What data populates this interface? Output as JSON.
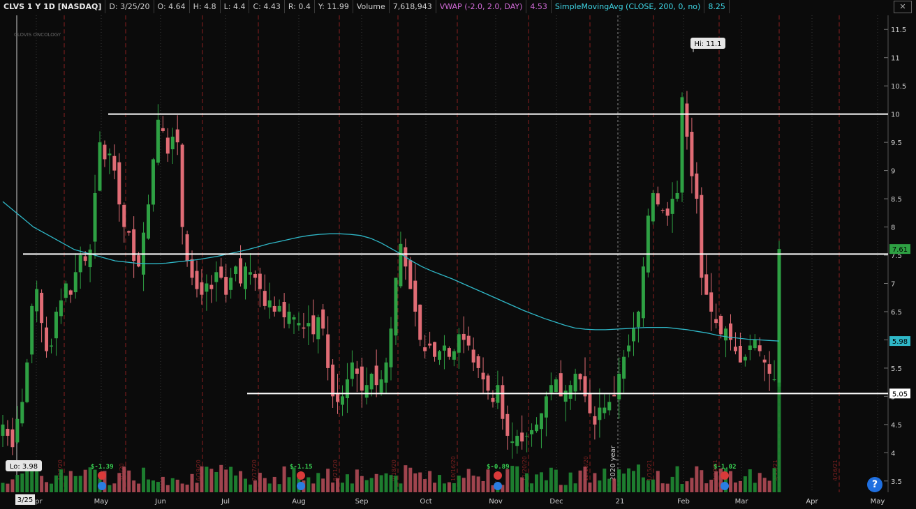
{
  "header": {
    "symbol": "CLVS 1 Y 1D [NASDAQ]",
    "date": "D: 3/25/20",
    "open": "O: 4.64",
    "high": "H: 4.8",
    "low": "L: 4.4",
    "close": "C: 4.43",
    "range": "R: 0.4",
    "year_high": "Y: 11.99",
    "volume_label": "Volume",
    "volume_value": "7,618,943",
    "vwap_label": "VWAP (-2.0, 2.0, DAY)",
    "vwap_value": "4.53",
    "sma_label": "SimpleMovingAvg (CLOSE, 200, 0, no)",
    "sma_value": "8.25",
    "close_icon": "close-icon"
  },
  "logo_text": "CLOVIS ONCOLOGY",
  "help_label": "?",
  "colors": {
    "background": "#0b0b0b",
    "up": "#2ea043",
    "down": "#e06c75",
    "sma": "#2fb8c8",
    "support": "#ffffff",
    "grid": "#3a3a3a",
    "event_line": "#8a1f1f",
    "earnings": "#39d353"
  },
  "chart_data": {
    "type": "candlestick",
    "ylim": [
      3.3,
      11.75
    ],
    "y_ticks": [
      "3.5",
      "4",
      "4.5",
      "5",
      "5.5",
      "6",
      "6.5",
      "7",
      "7.5",
      "8",
      "8.5",
      "9",
      "9.5",
      "10",
      "10.5",
      "11",
      "11.5"
    ],
    "x_months": [
      "Apr",
      "May",
      "Jun",
      "Jul",
      "Aug",
      "Sep",
      "Oct",
      "Nov",
      "Dec",
      "21",
      "Feb",
      "Mar",
      "Apr",
      "May"
    ],
    "year_divider_label": "2020 year",
    "support_levels": [
      {
        "price": 10.0
      },
      {
        "price": 7.52
      },
      {
        "price": 5.05
      }
    ],
    "price_badges": [
      {
        "label": "7.61",
        "price": 7.61,
        "color": "#2ea043"
      },
      {
        "label": "5.98",
        "price": 5.98,
        "color": "#2fb8c8"
      },
      {
        "label": "5.05",
        "price": 5.05,
        "color": "#ffffff"
      }
    ],
    "hi_label": "Hi: 11.1",
    "lo_label": "Lo: 3.98",
    "cursor_date": "3/25",
    "event_dates": [
      "4/17/20",
      "5/7/20",
      "6/19/20",
      "7/17/20",
      "8/21/20",
      "9/18/20",
      "10/16/20",
      "11/20/20",
      "12/18/20",
      "1/15/21",
      "2/19/21",
      "3/19/21",
      "4/16/21"
    ],
    "earnings": [
      "$-1.39",
      "$-1.15",
      "$-0.89",
      "$-1.02"
    ],
    "close_series": [
      4.5,
      4.3,
      4.1,
      4.6,
      4.9,
      5.6,
      6.6,
      6.9,
      6.3,
      5.8,
      5.9,
      6.5,
      6.7,
      7.0,
      6.8,
      7.2,
      7.5,
      7.4,
      7.6,
      8.6,
      9.5,
      9.2,
      9.3,
      9.0,
      8.4,
      8.0,
      7.9,
      7.4,
      7.3,
      7.9,
      8.4,
      9.2,
      9.9,
      9.7,
      9.3,
      9.6,
      9.5,
      8.0,
      7.4,
      7.1,
      6.9,
      6.8,
      7.0,
      6.9,
      7.2,
      7.1,
      6.8,
      7.1,
      7.3,
      7.0,
      7.3,
      7.2,
      7.1,
      6.9,
      6.6,
      6.7,
      6.5,
      6.6,
      6.4,
      6.5,
      6.4,
      6.3,
      6.2,
      6.3,
      6.1,
      6.4,
      6.2,
      5.5,
      5.0,
      4.9,
      5.0,
      5.3,
      5.6,
      5.4,
      5.1,
      5.2,
      5.4,
      5.2,
      5.3,
      5.6,
      6.2,
      7.1,
      7.7,
      7.3,
      6.9,
      6.5,
      6.0,
      5.8,
      5.9,
      5.7,
      5.8,
      5.9,
      5.7,
      5.8,
      6.1,
      6.0,
      5.9,
      5.6,
      5.5,
      5.3,
      5.1,
      4.9,
      5.2,
      4.6,
      4.3,
      4.2,
      4.3,
      4.2,
      4.3,
      4.4,
      4.5,
      4.7,
      5.0,
      5.2,
      5.3,
      5.0,
      5.1,
      5.2,
      5.4,
      5.3,
      5.0,
      4.7,
      4.5,
      4.8,
      4.8,
      4.9,
      5.0,
      5.4,
      5.7,
      5.9,
      6.2,
      6.5,
      7.3,
      8.2,
      8.6,
      8.4,
      8.3,
      8.2,
      8.5,
      8.6,
      10.3,
      9.6,
      8.9,
      8.5,
      7.1,
      6.8,
      6.5,
      6.3,
      6.1,
      6.2,
      6.0,
      5.8,
      5.6,
      5.7,
      5.9,
      6.0,
      5.8,
      5.6,
      5.4,
      5.3,
      7.61
    ],
    "sma_series": [
      8.45,
      8.3,
      8.15,
      8.0,
      7.9,
      7.8,
      7.7,
      7.6,
      7.55,
      7.5,
      7.45,
      7.4,
      7.38,
      7.36,
      7.35,
      7.35,
      7.36,
      7.38,
      7.4,
      7.42,
      7.45,
      7.48,
      7.52,
      7.56,
      7.6,
      7.65,
      7.7,
      7.74,
      7.78,
      7.82,
      7.85,
      7.87,
      7.88,
      7.88,
      7.87,
      7.85,
      7.8,
      7.72,
      7.62,
      7.52,
      7.4,
      7.3,
      7.22,
      7.15,
      7.08,
      7.0,
      6.92,
      6.84,
      6.76,
      6.68,
      6.6,
      6.52,
      6.45,
      6.38,
      6.32,
      6.26,
      6.21,
      6.19,
      6.18,
      6.18,
      6.19,
      6.2,
      6.21,
      6.22,
      6.22,
      6.22,
      6.2,
      6.18,
      6.15,
      6.12,
      6.08,
      6.05,
      6.03,
      6.01,
      6.0,
      5.99,
      5.98
    ]
  }
}
